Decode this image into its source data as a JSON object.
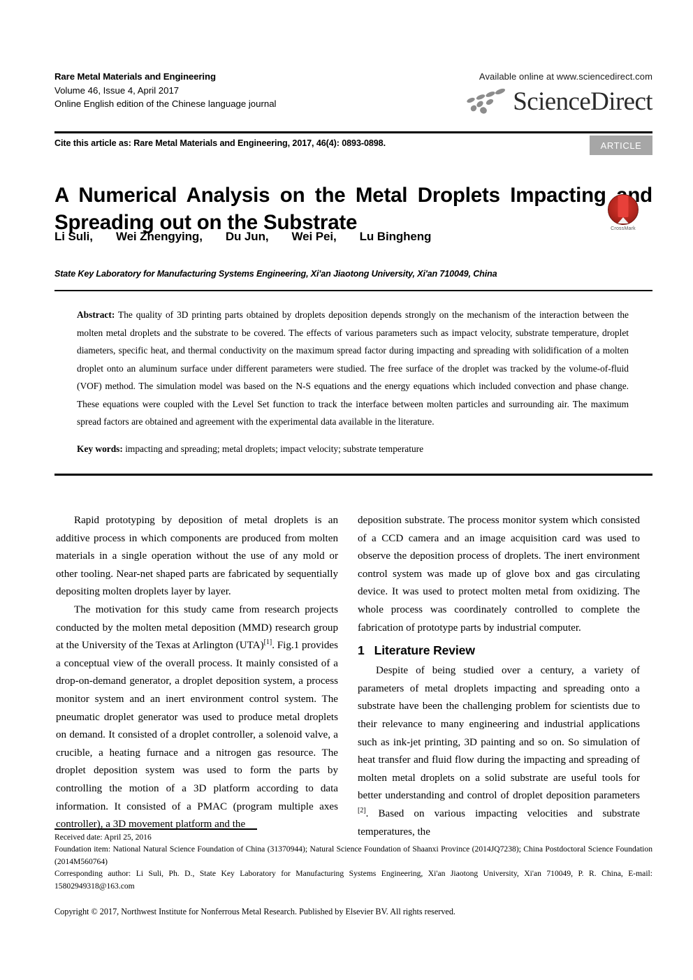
{
  "masthead": {
    "journal_name": "Rare Metal Materials and Engineering",
    "volume_line": "Volume 46, Issue 4, April 2017",
    "edition_line": "Online English edition of the Chinese language journal",
    "available_online": "Available online at www.sciencedirect.com",
    "sciencedirect_wordmark": "ScienceDirect"
  },
  "cite": {
    "text": "Cite this article as: Rare Metal Materials and Engineering, 2017, 46(4): 0893-0898.",
    "badge": "ARTICLE"
  },
  "title": {
    "line1": "A Numerical Analysis on the Metal Droplets Impacting and",
    "line2": "Spreading out on the Substrate"
  },
  "crossmark": {
    "label": "CrossMark"
  },
  "authors": [
    "Li Suli,",
    "Wei Zhengying,",
    "Du Jun,",
    "Wei Pei,",
    "Lu Bingheng"
  ],
  "affiliation": "State Key Laboratory for Manufacturing Systems Engineering, Xi'an Jiaotong University,  Xi'an 710049, China",
  "abstract": {
    "label": "Abstract:",
    "body": " The quality of 3D printing parts obtained by droplets deposition depends strongly on the mechanism of the interaction between the molten metal droplets and the substrate to be covered. The effects of various parameters such as impact velocity, substrate temperature, droplet diameters, specific heat, and thermal conductivity on the maximum spread factor during impacting and spreading with solidification of a molten droplet onto an aluminum surface under different parameters were studied. The free surface of the droplet was tracked by the volume-of-fluid (VOF) method. The simulation model was based on the N-S equations and the energy equations which included convection and phase change. These equations were coupled with the Level Set function to track the interface between molten particles and surrounding air. The maximum spread factors are obtained and agreement with the experimental data available in the literature."
  },
  "keywords": {
    "label": "Key words:",
    "body": " impacting and spreading; metal droplets; impact velocity; substrate temperature"
  },
  "body": {
    "left": {
      "p1": "Rapid prototyping by deposition of metal droplets is an additive process in which components are produced from molten materials in a single operation without the use of any mold or other tooling. Near-net shaped parts are fabricated by sequentially depositing molten droplets layer by layer.",
      "p2_a": "The motivation for this study came from research projects conducted by the molten metal deposition (MMD) research group at the University of the Texas at Arlington (UTA)",
      "p2_sup": "[1]",
      "p2_b": ". Fig.1 provides a conceptual view of the overall process. It mainly consisted of a drop-on-demand generator, a droplet deposition system, a process monitor system and an inert environment control system. The pneumatic droplet generator was used to produce metal droplets on demand. It consisted of a droplet controller, a solenoid valve, a crucible, a heating furnace and a nitrogen gas resource. The droplet deposition system was used to form the parts by controlling the motion of a 3D platform according to data information. It consisted of a PMAC (program multiple axes controller), a 3D movement platform and the"
    },
    "right": {
      "p1": "deposition substrate. The process monitor system which consisted of a CCD camera and an image acquisition card was used to observe the deposition process of droplets. The inert environment control system was made up of glove box and gas circulating device. It was used to protect molten metal from oxidizing. The whole process was coordinately controlled to complete the fabrication of prototype parts by industrial computer.",
      "section_number": "1",
      "section_title": "Literature Review",
      "p2_a": "Despite of being studied over a century, a variety of parameters of metal droplets impacting and spreading onto a substrate have been the challenging problem for scientists due to their relevance to many engineering and industrial applications such as ink-jet printing, 3D painting and so on. So simulation of heat transfer and fluid flow during the impacting and spreading of molten metal droplets on a solid substrate are useful tools for better understanding and control of droplet deposition parameters ",
      "p2_sup": "[2]",
      "p2_b": ". Based on various impacting velocities and substrate temperatures, the"
    }
  },
  "footnotes": {
    "received": "Received date: April 25, 2016",
    "foundation": "Foundation item: National Natural Science Foundation of China  (31370944); Natural Science Foundation of Shaanxi Province (2014JQ7238); China Postdoctoral Science Foundation (2014M560764)",
    "corresponding": "Corresponding author: Li Suli, Ph. D., State Key Laboratory for Manufacturing Systems Engineering, Xi'an Jiaotong University,  Xi'an 710049, P. R. China, E-mail: 15802949318@163.com",
    "copyright": "Copyright © 2017, Northwest Institute for Nonferrous Metal Research. Published by Elsevier BV. All rights reserved."
  },
  "colors": {
    "badge_bg": "#a6a6a6",
    "crossmark_red": "#b3261e",
    "text": "#000000"
  }
}
